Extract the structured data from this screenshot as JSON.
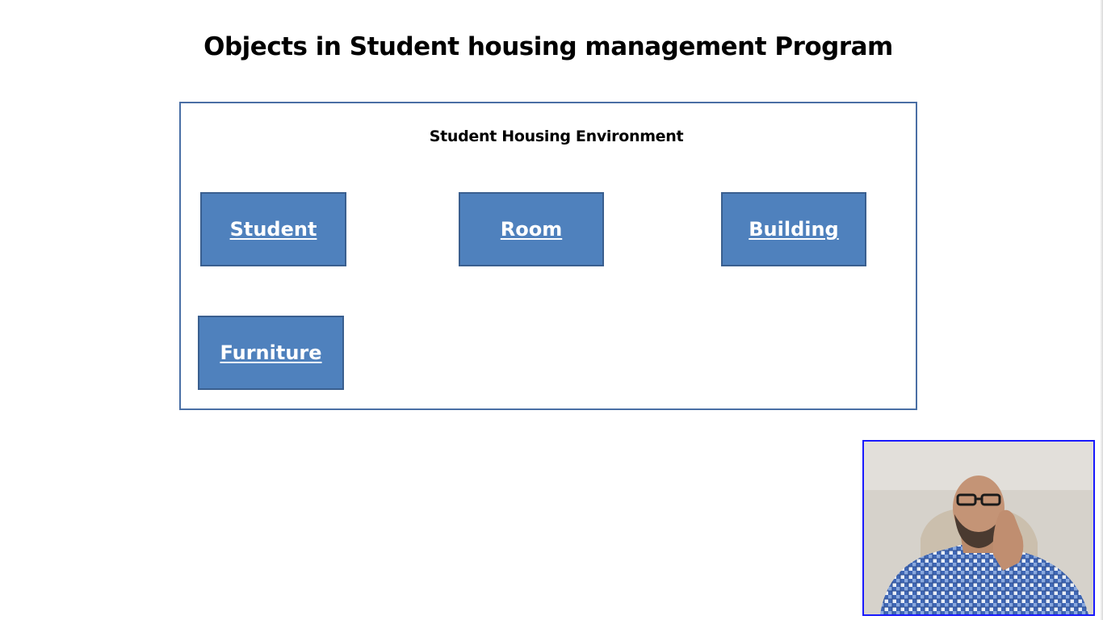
{
  "slide": {
    "title": "Objects in Student housing management Program"
  },
  "environment": {
    "label": "Student Housing Environment",
    "border_color": "#4a6fa5"
  },
  "objects": [
    {
      "label": "Student"
    },
    {
      "label": "Room"
    },
    {
      "label": "Building"
    },
    {
      "label": "Furniture"
    }
  ],
  "colors": {
    "object_fill": "#4f81bd",
    "object_text": "#ffffff",
    "webcam_border": "#1a1aff"
  },
  "webcam": {
    "icon": "presenter-webcam"
  }
}
